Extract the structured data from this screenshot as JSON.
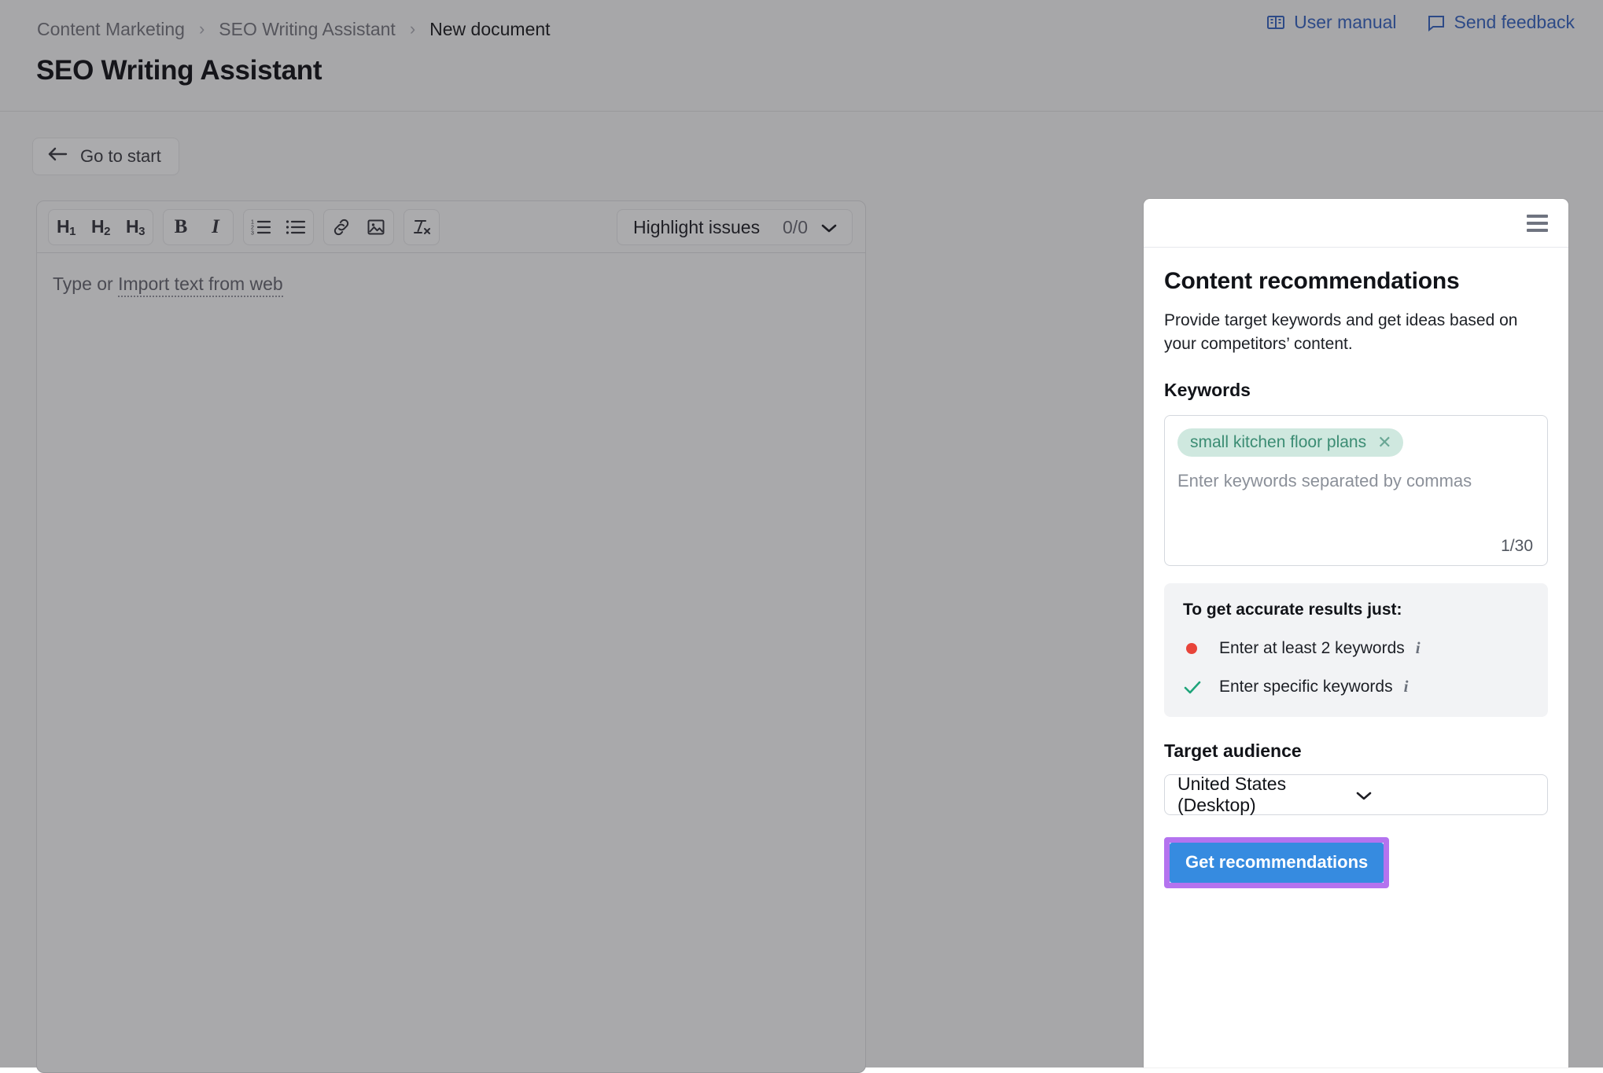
{
  "header": {
    "breadcrumb": [
      "Content Marketing",
      "SEO Writing Assistant",
      "New document"
    ],
    "breadcrumb_separator": "›",
    "title": "SEO Writing Assistant",
    "links": [
      {
        "label": "User manual",
        "icon": "book-icon"
      },
      {
        "label": "Send feedback",
        "icon": "speech-bubble-icon"
      }
    ],
    "link_color": "#2d4a87"
  },
  "toolbar": {
    "go_to_start": "Go to start",
    "back_arrow": "←"
  },
  "editor": {
    "format_buttons": [
      {
        "name": "heading-1",
        "label": "H",
        "sub": "1"
      },
      {
        "name": "heading-2",
        "label": "H",
        "sub": "2"
      },
      {
        "name": "heading-3",
        "label": "H",
        "sub": "3"
      },
      {
        "name": "bold",
        "label": "B"
      },
      {
        "name": "italic",
        "label": "I"
      },
      {
        "name": "ordered-list",
        "label": ""
      },
      {
        "name": "bulleted-list",
        "label": ""
      },
      {
        "name": "link",
        "label": ""
      },
      {
        "name": "image",
        "label": ""
      },
      {
        "name": "clear-formatting",
        "label": "Tx"
      }
    ],
    "highlight_issues_label": "Highlight issues",
    "highlight_issues_count": "0/0",
    "placeholder_prefix": "Type or ",
    "placeholder_link": "Import text from web"
  },
  "panel": {
    "title": "Content recommendations",
    "subtitle": "Provide target keywords and get ideas based on your competitors’ content.",
    "keywords_heading": "Keywords",
    "keyword_tags": [
      "small kitchen floor plans"
    ],
    "keyword_tag_remove": "✕",
    "keywords_placeholder": "Enter keywords separated by commas",
    "keywords_counter": "1/30",
    "keyword_tag_bg": "#cfe8df",
    "keyword_tag_color": "#3b8c73",
    "tips_title": "To get accurate results just:",
    "tips": [
      {
        "label": "Enter at least 2 keywords",
        "state": "error",
        "mark": "●",
        "info": "i"
      },
      {
        "label": "Enter specific keywords",
        "state": "ok",
        "mark": "✓",
        "info": "i"
      }
    ],
    "tips_error_color": "#e8443a",
    "tips_ok_color": "#1fa47a",
    "audience_heading": "Target audience",
    "audience_value": "United States (Desktop)",
    "audience_chevron": "∨",
    "cta_label": "Get recommendations",
    "cta_bg": "#368be0",
    "cta_highlight": "#b473ef",
    "menu_icon": "hamburger-menu-icon"
  }
}
